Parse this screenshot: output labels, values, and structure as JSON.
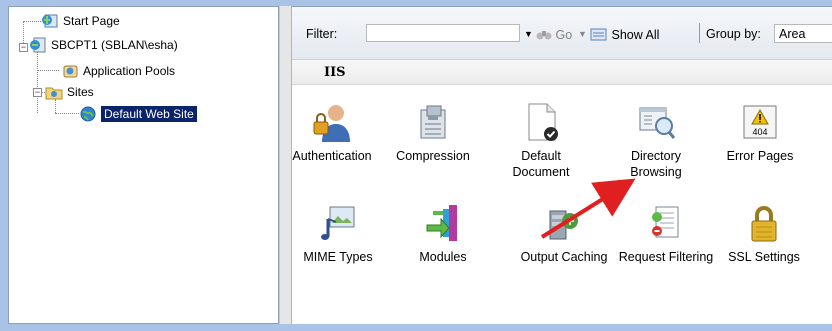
{
  "tree": {
    "items": [
      {
        "label": "Start Page"
      },
      {
        "label": "SBCPT1 (SBLAN\\esha)"
      },
      {
        "label": "Application Pools"
      },
      {
        "label": "Sites"
      },
      {
        "label": "Default Web Site"
      }
    ]
  },
  "toolbar": {
    "filter_label": "Filter:",
    "filter_value": "",
    "go_label": "Go",
    "show_all_label": "Show All",
    "group_by_label": "Group by:",
    "group_by_value": "Area"
  },
  "section": {
    "title": "IIS"
  },
  "features": [
    {
      "label": "Authentication",
      "icon": "authentication-icon"
    },
    {
      "label": "Compression",
      "icon": "compression-icon"
    },
    {
      "label": "Default Document",
      "icon": "default-document-icon"
    },
    {
      "label": "Directory Browsing",
      "icon": "directory-browsing-icon"
    },
    {
      "label": "Error Pages",
      "icon": "error-pages-icon"
    },
    {
      "label": "MIME Types",
      "icon": "mime-types-icon"
    },
    {
      "label": "Modules",
      "icon": "modules-icon"
    },
    {
      "label": "Output Caching",
      "icon": "output-caching-icon"
    },
    {
      "label": "Request Filtering",
      "icon": "request-filtering-icon"
    },
    {
      "label": "SSL Settings",
      "icon": "ssl-settings-icon"
    }
  ],
  "error_icon_text": "404",
  "colors": {
    "selection": "#0a246a",
    "background": "#a9c3e6",
    "arrow": "#e02020"
  }
}
